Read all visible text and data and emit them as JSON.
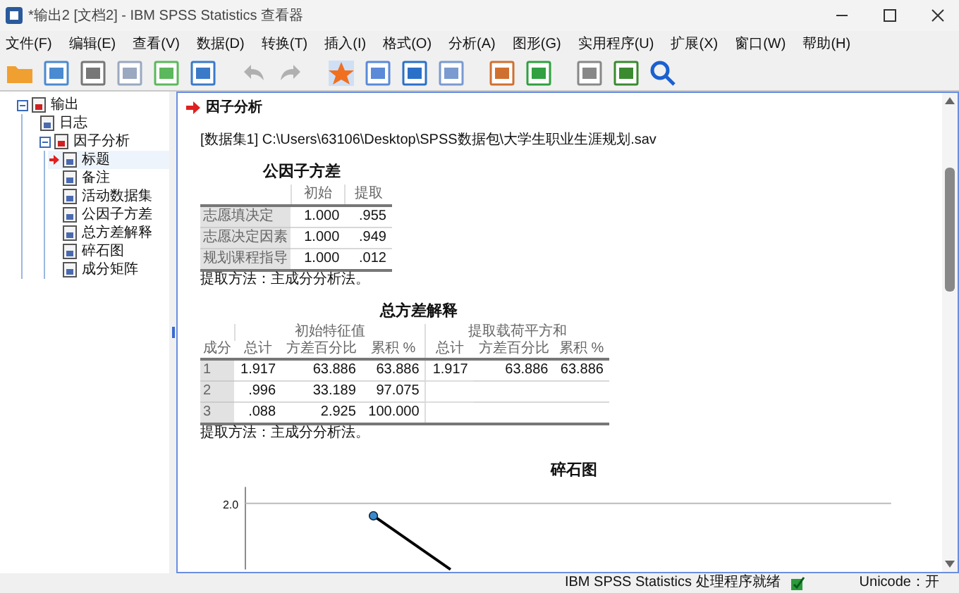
{
  "window": {
    "title": "*输出2 [文档2] - IBM SPSS Statistics 查看器"
  },
  "menu": [
    "文件(F)",
    "编辑(E)",
    "查看(V)",
    "数据(D)",
    "转换(T)",
    "插入(I)",
    "格式(O)",
    "分析(A)",
    "图形(G)",
    "实用程序(U)",
    "扩展(X)",
    "窗口(W)",
    "帮助(H)"
  ],
  "tree": [
    {
      "label": "输出",
      "expanded": true,
      "current": false,
      "children": [
        {
          "label": "日志",
          "current": false
        },
        {
          "label": "因子分析",
          "expanded": true,
          "current": false,
          "children": [
            {
              "label": "标题",
              "current": true
            },
            {
              "label": "备注",
              "current": false
            },
            {
              "label": "活动数据集",
              "current": false
            },
            {
              "label": "公因子方差",
              "current": false
            },
            {
              "label": "总方差解释",
              "current": false
            },
            {
              "label": "碎石图",
              "current": false
            },
            {
              "label": "成分矩阵",
              "current": false
            }
          ]
        }
      ]
    }
  ],
  "content": {
    "heading": "因子分析",
    "dataset_path": "[数据集1] C:\\Users\\63106\\Desktop\\SPSS数据包\\大学生职业生涯规划.sav",
    "communalities": {
      "title": "公因子方差",
      "columns": [
        "初始",
        "提取"
      ],
      "rows": [
        {
          "label": "志愿填决定",
          "values": [
            "1.000",
            ".955"
          ]
        },
        {
          "label": "志愿决定因素",
          "values": [
            "1.000",
            ".949"
          ]
        },
        {
          "label": "规划课程指导",
          "values": [
            "1.000",
            ".012"
          ]
        }
      ],
      "note": "提取方法：主成分分析法。"
    },
    "total_variance": {
      "title": "总方差解释",
      "groups": [
        "初始特征值",
        "提取载荷平方和"
      ],
      "row_header": "成分",
      "columns": [
        "总计",
        "方差百分比",
        "累积 %",
        "总计",
        "方差百分比",
        "累积 %"
      ],
      "rows": [
        {
          "label": "1",
          "values": [
            "1.917",
            "63.886",
            "63.886",
            "1.917",
            "63.886",
            "63.886"
          ]
        },
        {
          "label": "2",
          "values": [
            ".996",
            "33.189",
            "97.075"
          ]
        },
        {
          "label": "3",
          "values": [
            ".088",
            "2.925",
            "100.000"
          ]
        }
      ],
      "note": "提取方法：主成分分析法。"
    },
    "scree_plot": {
      "title": "碎石图",
      "y_tick_label": "2.0"
    }
  },
  "status_bar": {
    "status": "IBM SPSS Statistics 处理程序就绪",
    "encoding": "Unicode：开"
  }
}
